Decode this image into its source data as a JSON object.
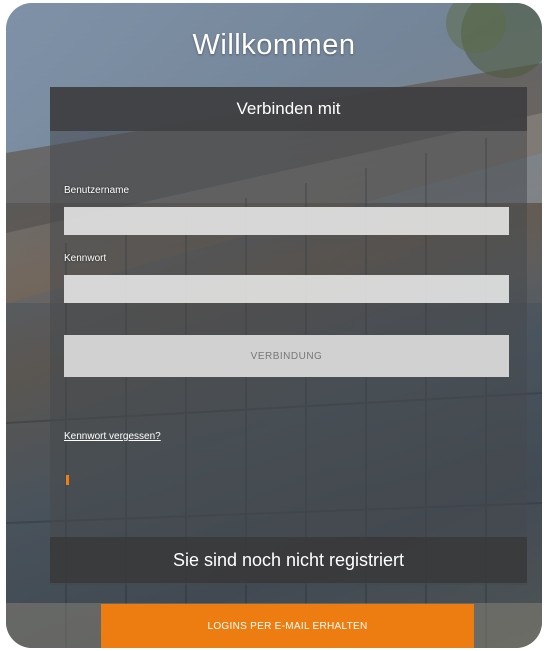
{
  "title": "Willkommen",
  "login": {
    "header": "Verbinden mit",
    "username_label": "Benutzername",
    "username_value": "",
    "password_label": "Kennwort",
    "password_value": "",
    "connect_button": "VERBINDUNG",
    "forgot_link": "Kennwort vergessen?"
  },
  "register": {
    "header": "Sie sind noch nicht registriert",
    "email_button": "LOGINS PER E-MAIL ERHALTEN"
  },
  "colors": {
    "accent": "#ee7d11",
    "header_bg": "#404042"
  }
}
